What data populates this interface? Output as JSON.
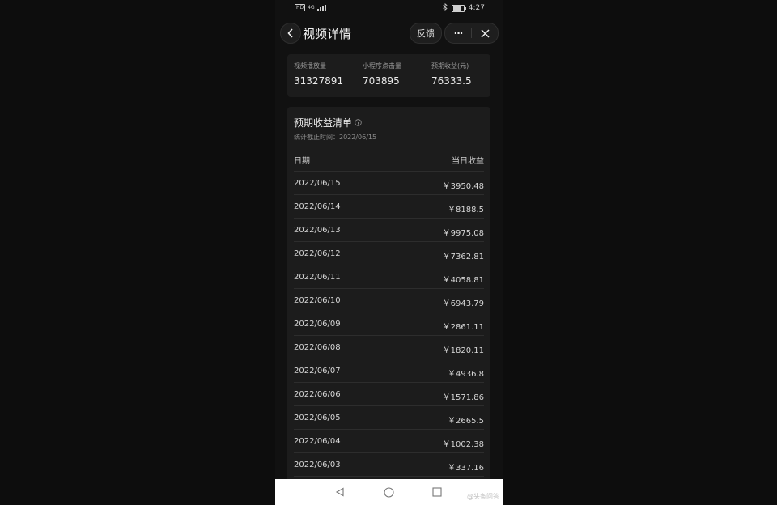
{
  "status_bar": {
    "badge": "HD",
    "network": "4G",
    "time": "4:27"
  },
  "nav": {
    "title": "视频详情",
    "feedback_label": "反馈",
    "more_label": "···"
  },
  "stats": [
    {
      "label": "视频播放量",
      "value": "31327891"
    },
    {
      "label": "小程序点击量",
      "value": "703895"
    },
    {
      "label": "预期收益(元)",
      "value": "76333.5"
    }
  ],
  "revenue": {
    "title": "预期收益清单",
    "subtitle": "统计截止时间：2022/06/15",
    "col_date": "日期",
    "col_amount": "当日收益",
    "rows": [
      {
        "date": "2022/06/15",
        "amount": "￥3950.48"
      },
      {
        "date": "2022/06/14",
        "amount": "￥8188.5"
      },
      {
        "date": "2022/06/13",
        "amount": "￥9975.08"
      },
      {
        "date": "2022/06/12",
        "amount": "￥7362.81"
      },
      {
        "date": "2022/06/11",
        "amount": "￥4058.81"
      },
      {
        "date": "2022/06/10",
        "amount": "￥6943.79"
      },
      {
        "date": "2022/06/09",
        "amount": "￥2861.11"
      },
      {
        "date": "2022/06/08",
        "amount": "￥1820.11"
      },
      {
        "date": "2022/06/07",
        "amount": "￥4936.8"
      },
      {
        "date": "2022/06/06",
        "amount": "￥1571.86"
      },
      {
        "date": "2022/06/05",
        "amount": "￥2665.5"
      },
      {
        "date": "2022/06/04",
        "amount": "￥1002.38"
      },
      {
        "date": "2022/06/03",
        "amount": "￥337.16"
      }
    ]
  },
  "watermark": "@头条问答"
}
